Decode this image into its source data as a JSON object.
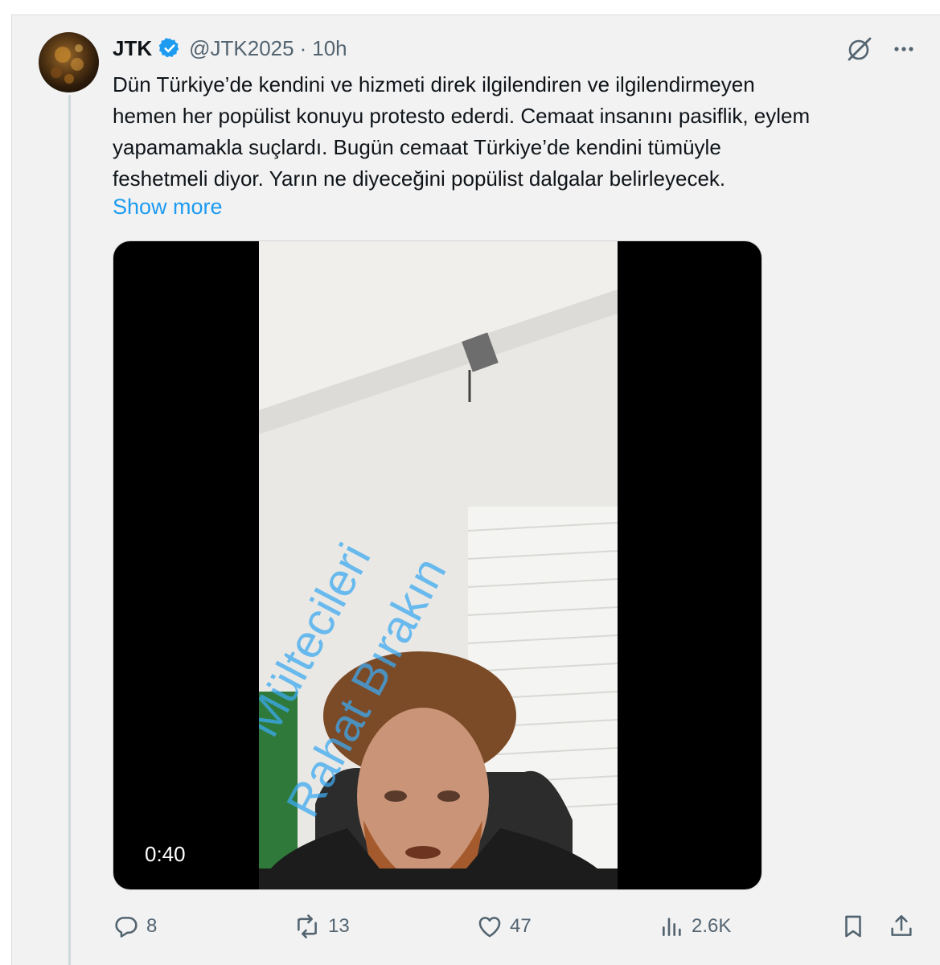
{
  "tweet": {
    "author_name": "JTK",
    "handle": "@JTK2025",
    "separator": "·",
    "time": "10h",
    "text_lines": [
      "Dün Türkiye’de kendini ve hizmeti direk ilgilendiren ve ilgilendirmeyen",
      "hemen her popülist konuyu protesto ederdi. Cemaat insanını pasiflik, eylem",
      "yapamamakla suçlardı. Bugün cemaat Türkiye’de kendini tümüyle",
      "feshetmeli diyor. Yarın ne diyeceğini popülist dalgalar belirleyecek."
    ],
    "show_more": "Show more"
  },
  "media": {
    "duration": "0:40",
    "watermark_line1": "Mültecileri",
    "watermark_line2": "Rahat Bırakın"
  },
  "actions": {
    "replies": "8",
    "reposts": "13",
    "likes": "47",
    "views": "2.6K"
  },
  "colors": {
    "accent": "#1d9bf0",
    "muted": "#536471",
    "verified": "#1d9bf0"
  },
  "icons": [
    "grok-icon",
    "more-icon",
    "verified-badge-icon",
    "reply-icon",
    "repost-icon",
    "like-icon",
    "views-icon",
    "bookmark-icon",
    "share-icon"
  ]
}
